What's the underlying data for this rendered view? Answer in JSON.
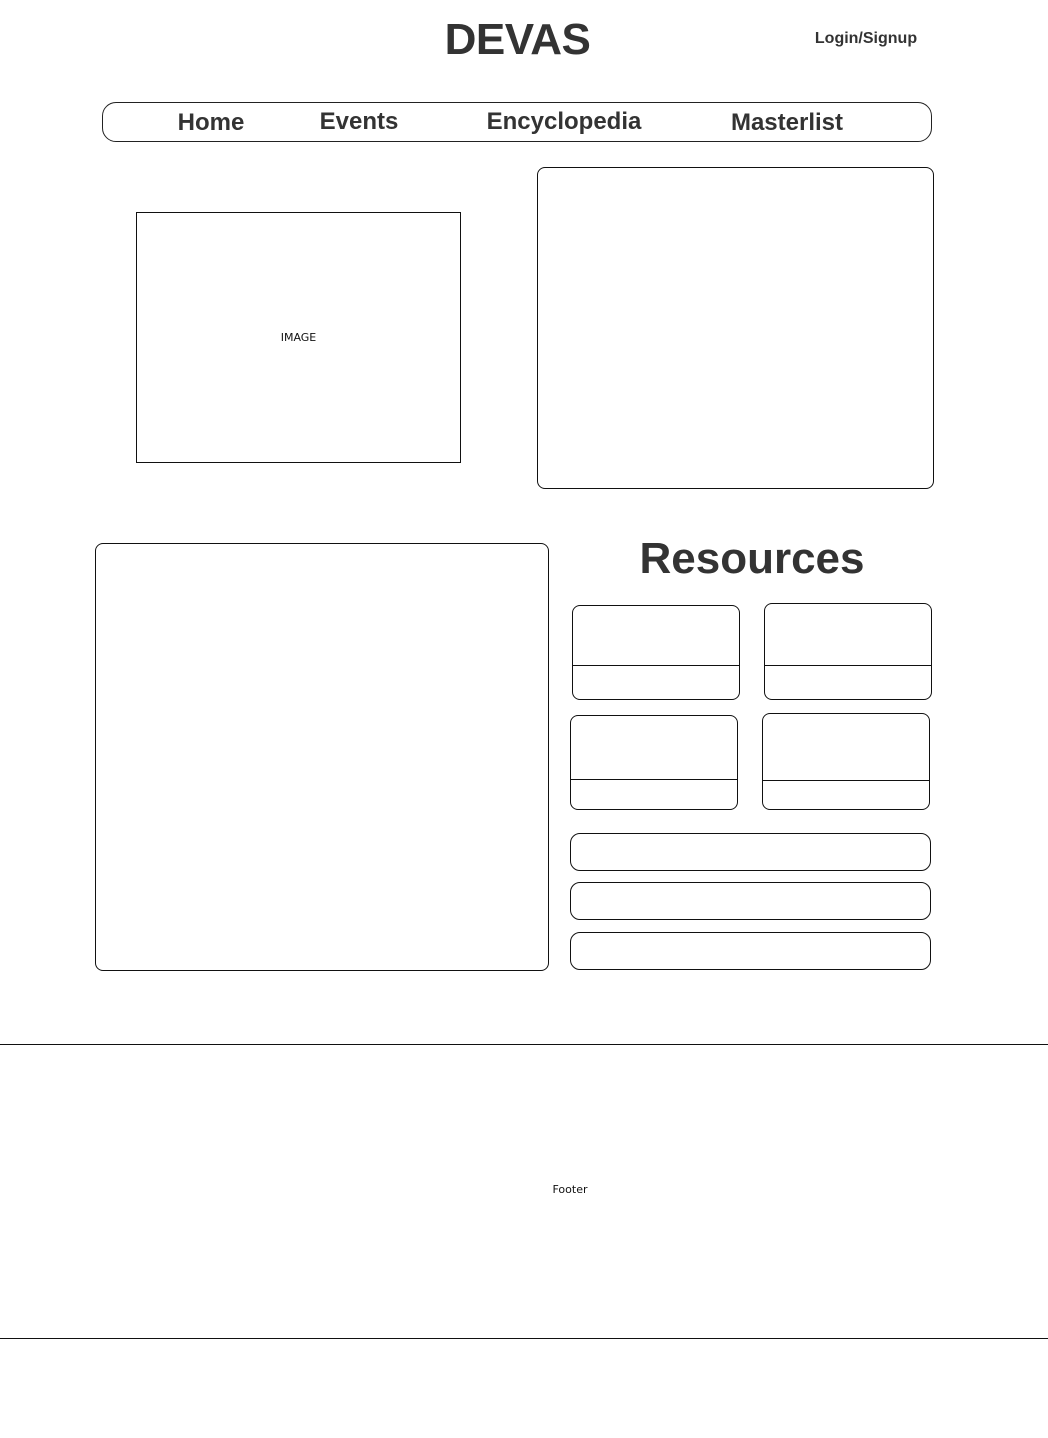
{
  "header": {
    "title": "DEVAS",
    "login_label": "Login/Signup"
  },
  "nav": {
    "items": [
      {
        "label": "Home"
      },
      {
        "label": "Events"
      },
      {
        "label": "Encyclopedia"
      },
      {
        "label": "Masterlist"
      }
    ]
  },
  "hero": {
    "image_placeholder": "IMAGE"
  },
  "resources": {
    "title": "Resources"
  },
  "footer": {
    "label": "Footer"
  }
}
